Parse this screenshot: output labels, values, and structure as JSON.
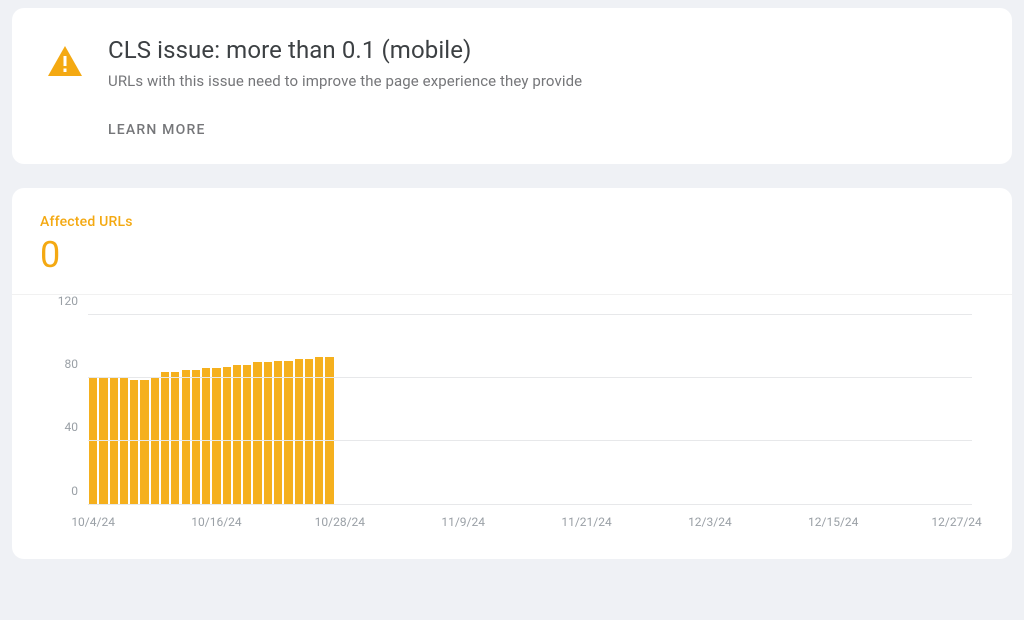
{
  "issue": {
    "title": "CLS issue: more than 0.1 (mobile)",
    "subtitle": "URLs with this issue need to improve the page experience they provide",
    "learn_more": "LEARN MORE",
    "icon": "warning-triangle"
  },
  "metric": {
    "label": "Affected URLs",
    "value": "0"
  },
  "chart_data": {
    "type": "bar",
    "title": "",
    "xlabel": "",
    "ylabel": "",
    "ylim": [
      0,
      120
    ],
    "y_ticks": [
      0,
      40,
      80,
      120
    ],
    "x_ticks": [
      "10/4/24",
      "10/16/24",
      "10/28/24",
      "11/9/24",
      "11/21/24",
      "12/3/24",
      "12/15/24",
      "12/27/24"
    ],
    "categories": [
      "10/4/24",
      "10/5/24",
      "10/6/24",
      "10/7/24",
      "10/8/24",
      "10/9/24",
      "10/10/24",
      "10/11/24",
      "10/12/24",
      "10/13/24",
      "10/14/24",
      "10/15/24",
      "10/16/24",
      "10/17/24",
      "10/18/24",
      "10/19/24",
      "10/20/24",
      "10/21/24",
      "10/22/24",
      "10/23/24",
      "10/24/24",
      "10/25/24",
      "10/26/24",
      "10/27/24",
      "10/28/24",
      "10/29/24",
      "10/30/24",
      "10/31/24",
      "11/1/24",
      "11/2/24",
      "11/3/24",
      "11/4/24",
      "11/5/24",
      "11/6/24",
      "11/7/24",
      "11/8/24",
      "11/9/24",
      "11/10/24",
      "11/11/24",
      "11/12/24",
      "11/13/24",
      "11/14/24",
      "11/15/24",
      "11/16/24",
      "11/17/24",
      "11/18/24",
      "11/19/24",
      "11/20/24",
      "11/21/24",
      "11/22/24",
      "11/23/24",
      "11/24/24",
      "11/25/24",
      "11/26/24",
      "11/27/24",
      "11/28/24",
      "11/29/24",
      "11/30/24",
      "12/1/24",
      "12/2/24",
      "12/3/24",
      "12/4/24",
      "12/5/24",
      "12/6/24",
      "12/7/24",
      "12/8/24",
      "12/9/24",
      "12/10/24",
      "12/11/24",
      "12/12/24",
      "12/13/24",
      "12/14/24",
      "12/15/24",
      "12/16/24",
      "12/17/24",
      "12/18/24",
      "12/19/24",
      "12/20/24",
      "12/21/24",
      "12/22/24",
      "12/23/24",
      "12/24/24",
      "12/25/24",
      "12/26/24",
      "12/27/24",
      "12/28/24"
    ],
    "values": [
      80,
      80,
      80,
      80,
      79,
      79,
      80,
      84,
      84,
      85,
      85,
      86,
      86,
      87,
      88,
      88,
      90,
      90,
      91,
      91,
      92,
      92,
      93,
      93,
      0,
      0,
      0,
      0,
      0,
      0,
      0,
      0,
      0,
      0,
      0,
      0,
      0,
      0,
      0,
      0,
      0,
      0,
      0,
      0,
      0,
      0,
      0,
      0,
      0,
      0,
      0,
      0,
      0,
      0,
      0,
      0,
      0,
      0,
      0,
      0,
      0,
      0,
      0,
      0,
      0,
      0,
      0,
      0,
      0,
      0,
      0,
      0,
      0,
      0,
      0,
      0,
      0,
      0,
      0,
      0,
      0,
      0,
      0,
      0,
      0,
      0
    ]
  },
  "colors": {
    "accent": "#f4a912",
    "bar": "#f5b01e"
  }
}
